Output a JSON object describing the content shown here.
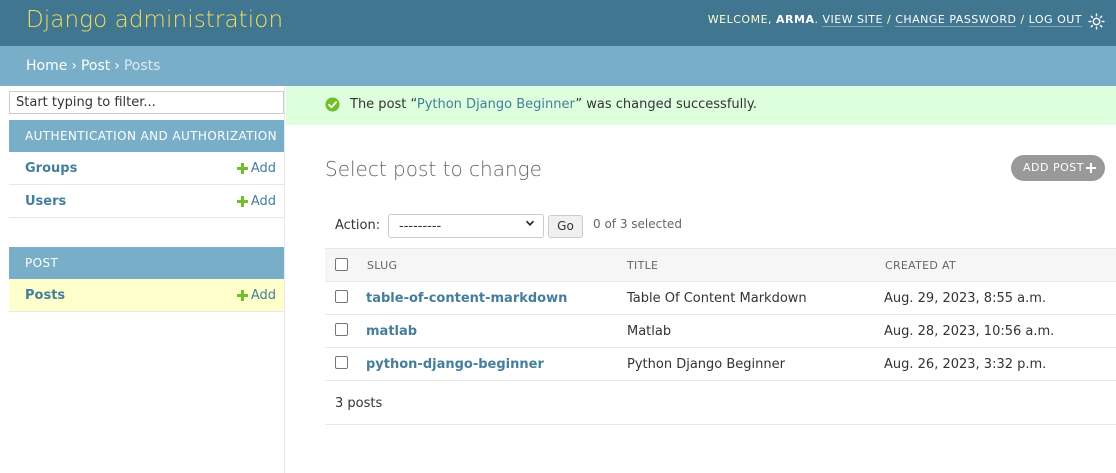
{
  "header": {
    "branding": "Django administration",
    "welcome_prefix": "WELCOME,",
    "username": "ARMA",
    "view_site": "VIEW SITE",
    "change_password": "CHANGE PASSWORD",
    "log_out": "LOG OUT",
    "separator": "/"
  },
  "breadcrumbs": {
    "home": "Home",
    "app": "Post",
    "current": "Posts",
    "separator": "›"
  },
  "sidebar": {
    "filter_placeholder": "Start typing to filter...",
    "modules": [
      {
        "caption": "Authentication and Authorization",
        "models": [
          {
            "name": "Groups",
            "add": "Add"
          },
          {
            "name": "Users",
            "add": "Add"
          }
        ]
      },
      {
        "caption": "Post",
        "models": [
          {
            "name": "Posts",
            "add": "Add",
            "selected": true
          }
        ]
      }
    ]
  },
  "message": {
    "before": "The post “",
    "link": "Python Django Beginner",
    "after": "” was changed successfully."
  },
  "main": {
    "title": "Select post to change",
    "add_button": "ADD POST",
    "action_label": "Action:",
    "action_value": "---------",
    "go_label": "Go",
    "selected_count": "0 of 3 selected",
    "columns": [
      "SLUG",
      "TITLE",
      "CREATED AT"
    ],
    "rows": [
      {
        "slug": "table-of-content-markdown",
        "title": "Table Of Content Markdown",
        "created_at": "Aug. 29, 2023, 8:55 a.m."
      },
      {
        "slug": "matlab",
        "title": "Matlab",
        "created_at": "Aug. 28, 2023, 10:56 a.m."
      },
      {
        "slug": "python-django-beginner",
        "title": "Python Django Beginner",
        "created_at": "Aug. 26, 2023, 3:32 p.m."
      }
    ],
    "paginator": "3 posts"
  },
  "colors": {
    "header_bg": "#417690",
    "branding": "#f5dd5d",
    "breadcrumb_bg": "#79aec8",
    "link": "#447e9b",
    "success_bg": "#dfd",
    "success_icon": "#70bf2b",
    "selected_row": "#ffffcc"
  },
  "icons": {
    "theme_toggle": "sun-icon",
    "success": "check-circle-icon",
    "add": "plus-icon"
  }
}
